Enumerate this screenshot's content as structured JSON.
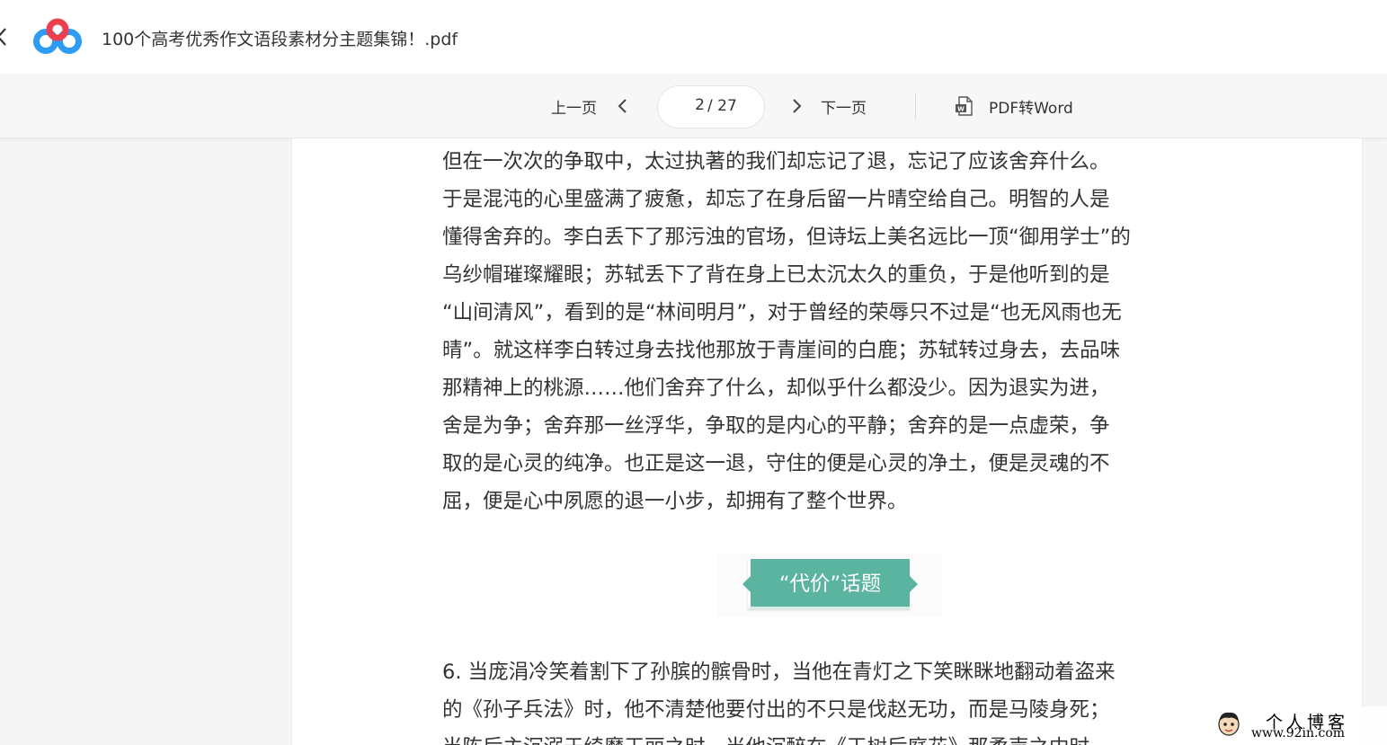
{
  "app": {
    "doc_title": "100个高考优秀作文语段素材分主题集锦！.pdf",
    "back_icon": "chevron-left-icon",
    "logo_icon": "cloud-drive-logo-icon"
  },
  "toolbar": {
    "prev_label": "上一页",
    "next_label": "下一页",
    "page_current": "2",
    "page_total": "/ 27",
    "convert_label": "PDF转Word",
    "convert_icon": "word-document-icon"
  },
  "document": {
    "paragraph1": [
      "但在一次次的争取中，太过执著的我们却忘记了退，忘记了应该舍弃什么。",
      "于是混沌的心里盛满了疲惫，却忘了在身后留一片晴空给自己。明智的人是",
      "懂得舍弃的。李白丢下了那污浊的官场，但诗坛上美名远比一顶“御用学士”的",
      "乌纱帽璀璨耀眼；苏轼丢下了背在身上已太沉太久的重负，于是他听到的是",
      "“山间清风”，看到的是“林间明月”，对于曾经的荣辱只不过是“也无风雨也无",
      "晴”。就这样李白转过身去找他那放于青崖间的白鹿；苏轼转过身去，去品味",
      "那精神上的桃源……他们舍弃了什么，却似乎什么都没少。因为退实为进，",
      "舍是为争；舍弃那一丝浮华，争取的是内心的平静；舍弃的是一点虚荣，争",
      "取的是心灵的纯净。也正是这一退，守住的便是心灵的净土，便是灵魂的不",
      "屈，便是心中夙愿的退一小步，却拥有了整个世界。"
    ],
    "topic_label": "“代价”话题",
    "paragraph2": [
      "6. 当庞涓冷笑着割下了孙膑的髌骨时，当他在青灯之下笑眯眯地翻动着盗来",
      "的《孙子兵法》时，他不清楚他要付出的不只是伐赵无功，而是马陵身死；",
      "当陈后主沉溺于绮靡玉丽之时，当他沉醉在《玉树后庭花》那柔声之中时，"
    ]
  },
  "watermark": {
    "title": "个人博客",
    "url": "www.92in.com"
  },
  "colors": {
    "topic_banner": "#5bb4a0",
    "logo_blue": "#2e9cf2",
    "logo_red": "#ef3e50",
    "text": "#333333"
  }
}
